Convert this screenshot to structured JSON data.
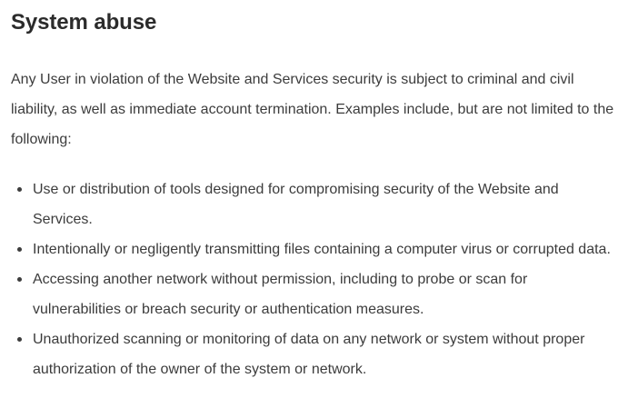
{
  "section": {
    "title": "System abuse",
    "intro": "Any User in violation of the Website and Services security is subject to criminal and civil liability, as well as immediate account termination. Examples include, but are not limited to the following:",
    "items": [
      "Use or distribution of tools designed for compromising security of the Website and Services.",
      "Intentionally or negligently transmitting files containing a computer virus or corrupted data.",
      "Accessing another network without permission, including to probe or scan for vulnerabilities or breach security or authentication measures.",
      "Unauthorized scanning or monitoring of data on any network or system without proper authorization of the owner of the system or network."
    ]
  }
}
